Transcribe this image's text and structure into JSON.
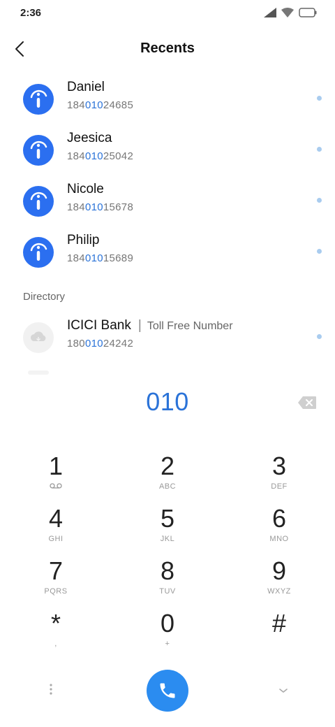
{
  "status": {
    "time": "2:36"
  },
  "header": {
    "title": "Recents"
  },
  "recents": [
    {
      "name": "Daniel",
      "number_pre": "184",
      "number_match": "010",
      "number_post": "24685"
    },
    {
      "name": "Jeesica",
      "number_pre": "184",
      "number_match": "010",
      "number_post": "25042"
    },
    {
      "name": "Nicole",
      "number_pre": "184",
      "number_match": "010",
      "number_post": "15678"
    },
    {
      "name": "Philip",
      "number_pre": "184",
      "number_match": "010",
      "number_post": "15689"
    }
  ],
  "directory": {
    "label": "Directory",
    "items": [
      {
        "name": "ICICI Bank",
        "separator": "|",
        "subtitle": "Toll Free Number",
        "number_pre": "180",
        "number_match": "010",
        "number_post": "24242"
      }
    ]
  },
  "dialer": {
    "input": "010",
    "keys": [
      {
        "digit": "1",
        "letters": "voicemail-icon"
      },
      {
        "digit": "2",
        "letters": "ABC"
      },
      {
        "digit": "3",
        "letters": "DEF"
      },
      {
        "digit": "4",
        "letters": "GHI"
      },
      {
        "digit": "5",
        "letters": "JKL"
      },
      {
        "digit": "6",
        "letters": "MNO"
      },
      {
        "digit": "7",
        "letters": "PQRS"
      },
      {
        "digit": "8",
        "letters": "TUV"
      },
      {
        "digit": "9",
        "letters": "WXYZ"
      },
      {
        "digit": "*",
        "letters": ","
      },
      {
        "digit": "0",
        "letters": "+"
      },
      {
        "digit": "#",
        "letters": ""
      }
    ]
  },
  "colors": {
    "accent": "#2b73d8",
    "avatar": "#2b6ff0",
    "call_button": "#2b8cf0"
  }
}
